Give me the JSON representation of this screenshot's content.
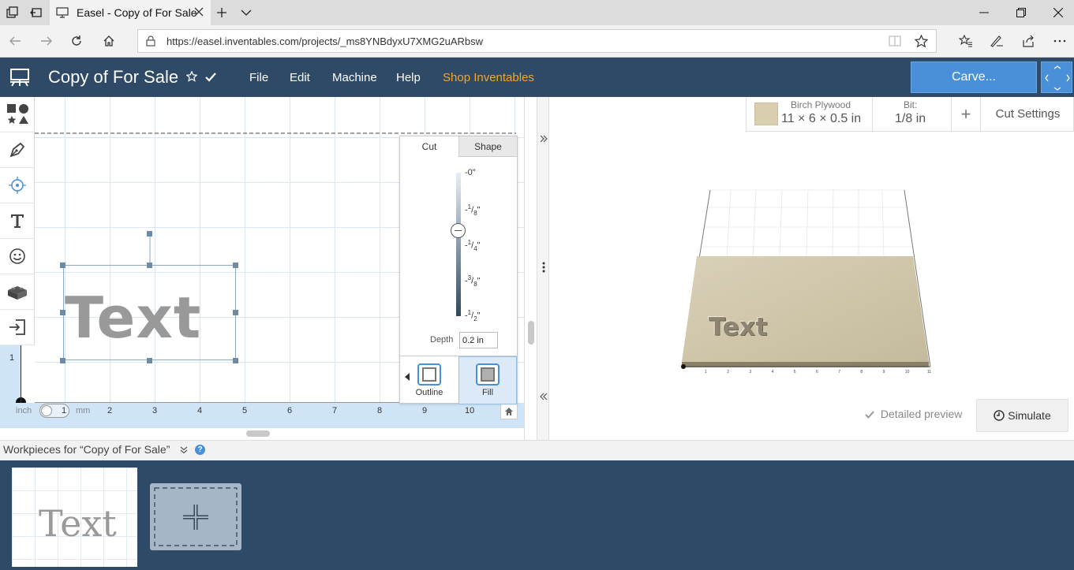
{
  "browser": {
    "tab_title": "Easel - Copy of For Sale",
    "url": "https://easel.inventables.com/projects/_ms8YNBdyxU7XMG2uARbsw"
  },
  "header": {
    "project_title": "Copy of For Sale",
    "menu": [
      "File",
      "Edit",
      "Machine",
      "Help",
      "Shop Inventables"
    ],
    "carve_label": "Carve...",
    "accent_color": "#f5a623",
    "brand_color": "#2e4a66"
  },
  "tools": [
    "shapes-icon",
    "pen-icon",
    "point-icon",
    "text-icon",
    "emoji-icon",
    "apps-icon",
    "import-icon"
  ],
  "canvas": {
    "text_object": "Text",
    "left_ruler_label": "1",
    "units": {
      "inch": "inch",
      "mm": "mm",
      "toggle_value": "1"
    },
    "ruler_numbers": [
      "2",
      "3",
      "4",
      "5",
      "6",
      "7",
      "8",
      "9",
      "10"
    ]
  },
  "cut_panel": {
    "tabs": [
      "Cut",
      "Shape"
    ],
    "active_tab": "Cut",
    "ticks": [
      {
        "sign": "-",
        "num": "0",
        "den": "",
        "unit": "\""
      },
      {
        "sign": "-",
        "num": "1",
        "den": "8",
        "unit": "\""
      },
      {
        "sign": "-",
        "num": "1",
        "den": "4",
        "unit": "\""
      },
      {
        "sign": "-",
        "num": "3",
        "den": "8",
        "unit": "\""
      },
      {
        "sign": "-",
        "num": "1",
        "den": "2",
        "unit": "\""
      }
    ],
    "depth_label": "Depth",
    "depth_value": "0.2 in",
    "depth_fraction_of_max": 0.4,
    "outline_label": "Outline",
    "fill_label": "Fill",
    "selected_fill": "Fill"
  },
  "material": {
    "name": "Birch Plywood",
    "size": "11 × 6 × 0.5 in",
    "bit_label": "Bit:",
    "bit_value": "1/8 in",
    "add_label": "+",
    "cut_settings_label": "Cut Settings"
  },
  "preview": {
    "carved_text": "Text",
    "axis_numbers": [
      "1",
      "2",
      "3",
      "4",
      "5",
      "6",
      "7",
      "8",
      "9",
      "10",
      "11"
    ],
    "detailed_preview_label": "Detailed preview",
    "simulate_label": "Simulate"
  },
  "workpieces": {
    "label": "Workpieces for “Copy of For Sale”",
    "thumbnail_text": "Text"
  }
}
